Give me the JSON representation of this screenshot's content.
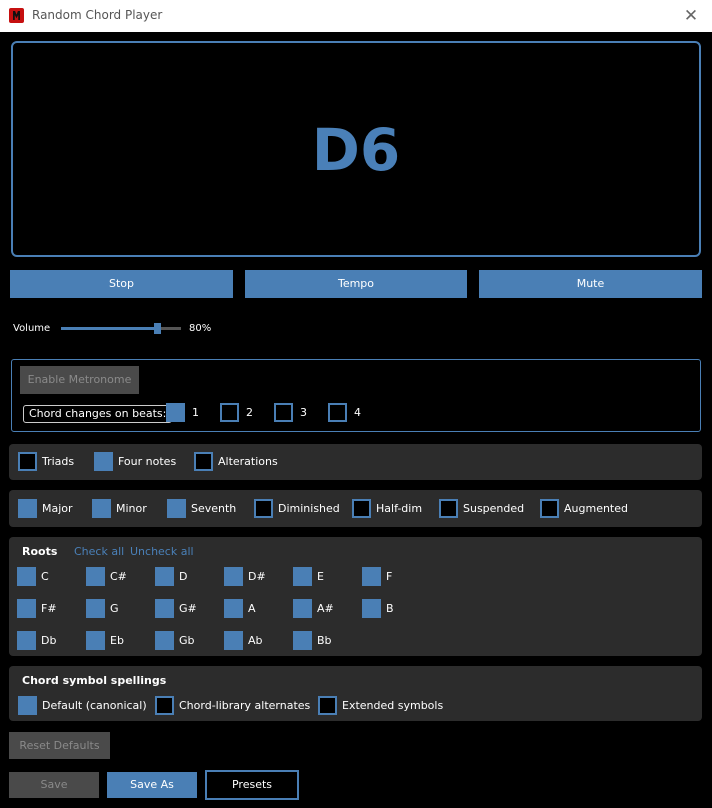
{
  "window": {
    "title": "Random Chord Player",
    "close": "✕"
  },
  "display": {
    "chord": "D6"
  },
  "controls": {
    "stop": "Stop",
    "tempo": "Tempo",
    "mute": "Mute"
  },
  "volume": {
    "label": "Volume",
    "value_text": "80%",
    "level": 0.8
  },
  "metronome": {
    "enable_label": "Enable Metronome",
    "beats_label": "Chord changes on beats:",
    "beats": [
      {
        "label": "1",
        "checked": true
      },
      {
        "label": "2",
        "checked": false
      },
      {
        "label": "3",
        "checked": false
      },
      {
        "label": "4",
        "checked": false
      }
    ]
  },
  "note_counts": [
    {
      "label": "Triads",
      "checked": false
    },
    {
      "label": "Four notes",
      "checked": true
    },
    {
      "label": "Alterations",
      "checked": false
    }
  ],
  "qualities": [
    {
      "label": "Major",
      "checked": true
    },
    {
      "label": "Minor",
      "checked": true
    },
    {
      "label": "Seventh",
      "checked": true
    },
    {
      "label": "Diminished",
      "checked": false
    },
    {
      "label": "Half-dim",
      "checked": false
    },
    {
      "label": "Suspended",
      "checked": false
    },
    {
      "label": "Augmented",
      "checked": false
    }
  ],
  "roots": {
    "title": "Roots",
    "check_all": "Check all",
    "uncheck_all": "Uncheck all",
    "rows": [
      [
        "C",
        "C#",
        "D",
        "D#",
        "E",
        "F"
      ],
      [
        "F#",
        "G",
        "G#",
        "A",
        "A#",
        "B"
      ],
      [
        "Db",
        "Eb",
        "Gb",
        "Ab",
        "Bb"
      ]
    ]
  },
  "spellings": {
    "title": "Chord symbol spellings",
    "options": [
      {
        "label": "Default (canonical)",
        "checked": true
      },
      {
        "label": "Chord-library alternates",
        "checked": false
      },
      {
        "label": "Extended symbols",
        "checked": false
      }
    ]
  },
  "footer": {
    "reset": "Reset Defaults",
    "save": "Save",
    "save_as": "Save As",
    "presets": "Presets"
  },
  "colors": {
    "accent": "#4a7fb5",
    "panel": "#2c2c2c",
    "background": "#000000"
  }
}
